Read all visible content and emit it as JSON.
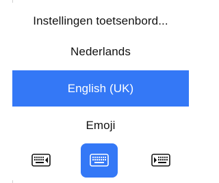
{
  "menu": {
    "settings_label": "Instellingen toetsenbord...",
    "languages": [
      {
        "label": "Nederlands",
        "selected": false
      },
      {
        "label": "English (UK)",
        "selected": true
      },
      {
        "label": "Emoji",
        "selected": false
      }
    ]
  },
  "keyboard_modes": [
    {
      "icon": "keyboard-dock-left-icon",
      "selected": false
    },
    {
      "icon": "keyboard-full-icon",
      "selected": true
    },
    {
      "icon": "keyboard-dock-right-icon",
      "selected": false
    }
  ],
  "colors": {
    "accent": "#3478f6",
    "text": "#111111",
    "background": "#ffffff"
  }
}
